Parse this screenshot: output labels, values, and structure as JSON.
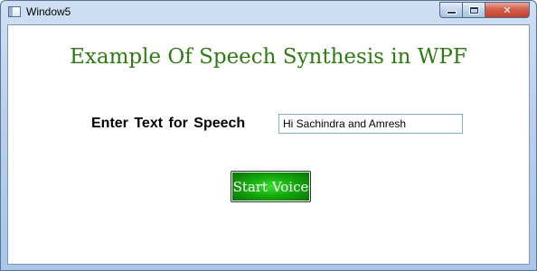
{
  "window": {
    "title": "Window5",
    "controls": {
      "minimize": "minimize",
      "maximize": "maximize",
      "close_glyph": "✕"
    }
  },
  "main": {
    "heading": "Example Of Speech Synthesis in WPF",
    "speech_label": "Enter Text for Speech",
    "speech_input_value": "Hi Sachindra and Amresh",
    "start_button_label": "Start Voice"
  },
  "colors": {
    "heading": "#2f7a12",
    "button_green": "#15a90e",
    "close_red": "#c2402b"
  }
}
